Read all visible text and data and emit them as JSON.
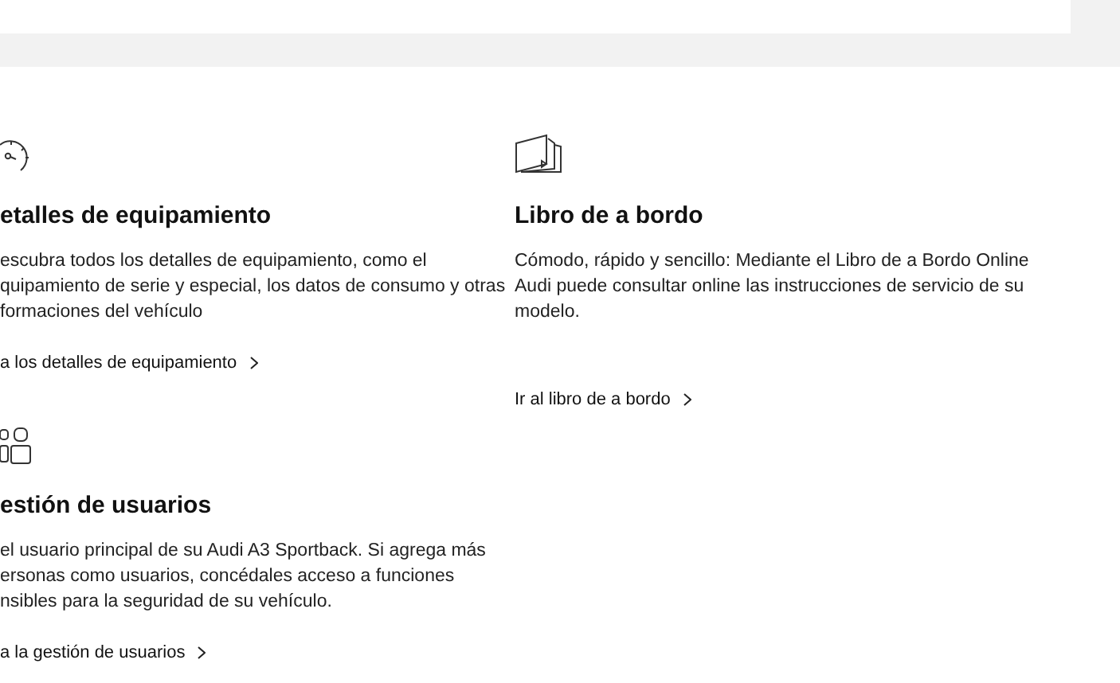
{
  "cards": [
    {
      "kind": "gauge",
      "title": "etalles de equipamiento",
      "lines": [
        "escubra todos los detalles de equipamiento, como el",
        "quipamiento de serie y especial, los datos de consumo y otras",
        "formaciones del vehículo"
      ],
      "link": "a los detalles de equipamiento"
    },
    {
      "kind": "users",
      "title": "estión de usuarios",
      "lines": [
        "el usuario principal de su Audi A3 Sportback. Si agrega más",
        "ersonas como usuarios, concédales acceso a funciones",
        "nsibles para la seguridad de su vehículo."
      ],
      "link": "a la gestión de usuarios"
    },
    {
      "kind": "book",
      "title": "Libro de a bordo",
      "lines": [
        "Cómodo, rápido y sencillo: Mediante el Libro de a Bordo Online",
        "Audi puede consultar online las instrucciones de servicio de su",
        "modelo."
      ],
      "link": "Ir al libro de a bordo"
    }
  ]
}
